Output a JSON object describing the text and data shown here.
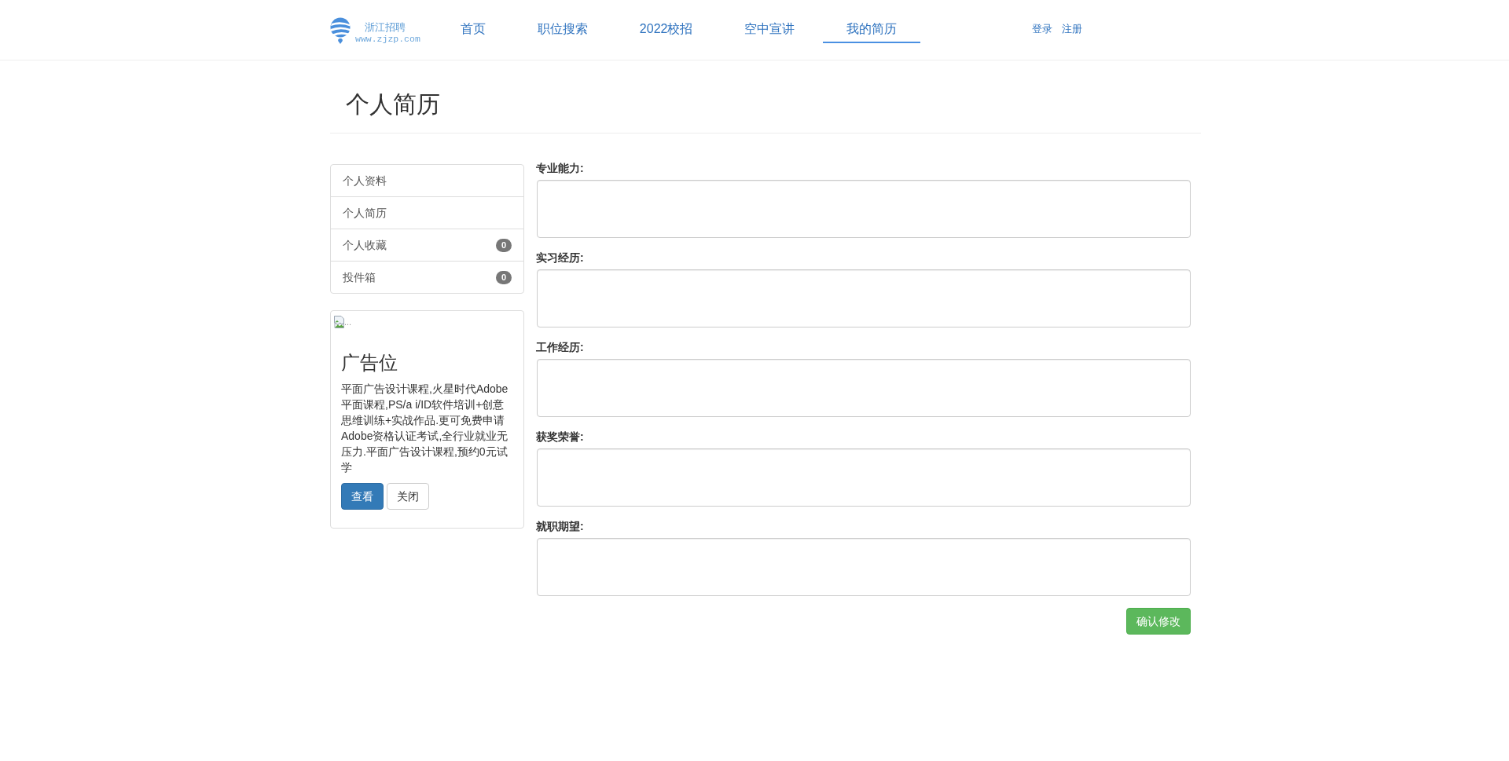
{
  "header": {
    "logo": {
      "name": "浙江招聘",
      "url": "www.zjzp.com"
    },
    "nav": [
      {
        "label": "首页",
        "selected": false
      },
      {
        "label": "职位搜索",
        "selected": false
      },
      {
        "label": "2022校招",
        "selected": false
      },
      {
        "label": "空中宣讲",
        "selected": false
      },
      {
        "label": "我的简历",
        "selected": true
      }
    ],
    "account_links": [
      "登录",
      "注册"
    ]
  },
  "page_title": "个人简历",
  "sidebar": {
    "menu": [
      {
        "label": "个人资料"
      },
      {
        "label": "个人简历"
      },
      {
        "label": "个人收藏",
        "badge": "0"
      },
      {
        "label": "投件箱",
        "badge": "0"
      }
    ],
    "ad_card": {
      "image_alt": "...",
      "title": "广告位",
      "text": "平面广告设计课程,火星时代Adobe平面课程,PS/a i/ID软件培训+创意思维训练+实战作品.更可免费申请Adobe资格认证考试,全行业就业无压力.平面广告设计课程,预约0元试学",
      "buttons": [
        {
          "label": "查看",
          "kind": "primary"
        },
        {
          "label": "关闭",
          "kind": "default"
        }
      ]
    }
  },
  "form": {
    "fields": [
      {
        "label": "专业能力:"
      },
      {
        "label": "实习经历:"
      },
      {
        "label": "工作经历:"
      },
      {
        "label": "获奖荣誉:"
      },
      {
        "label": "就职期望:"
      }
    ],
    "submit_button": "确认修改"
  }
}
